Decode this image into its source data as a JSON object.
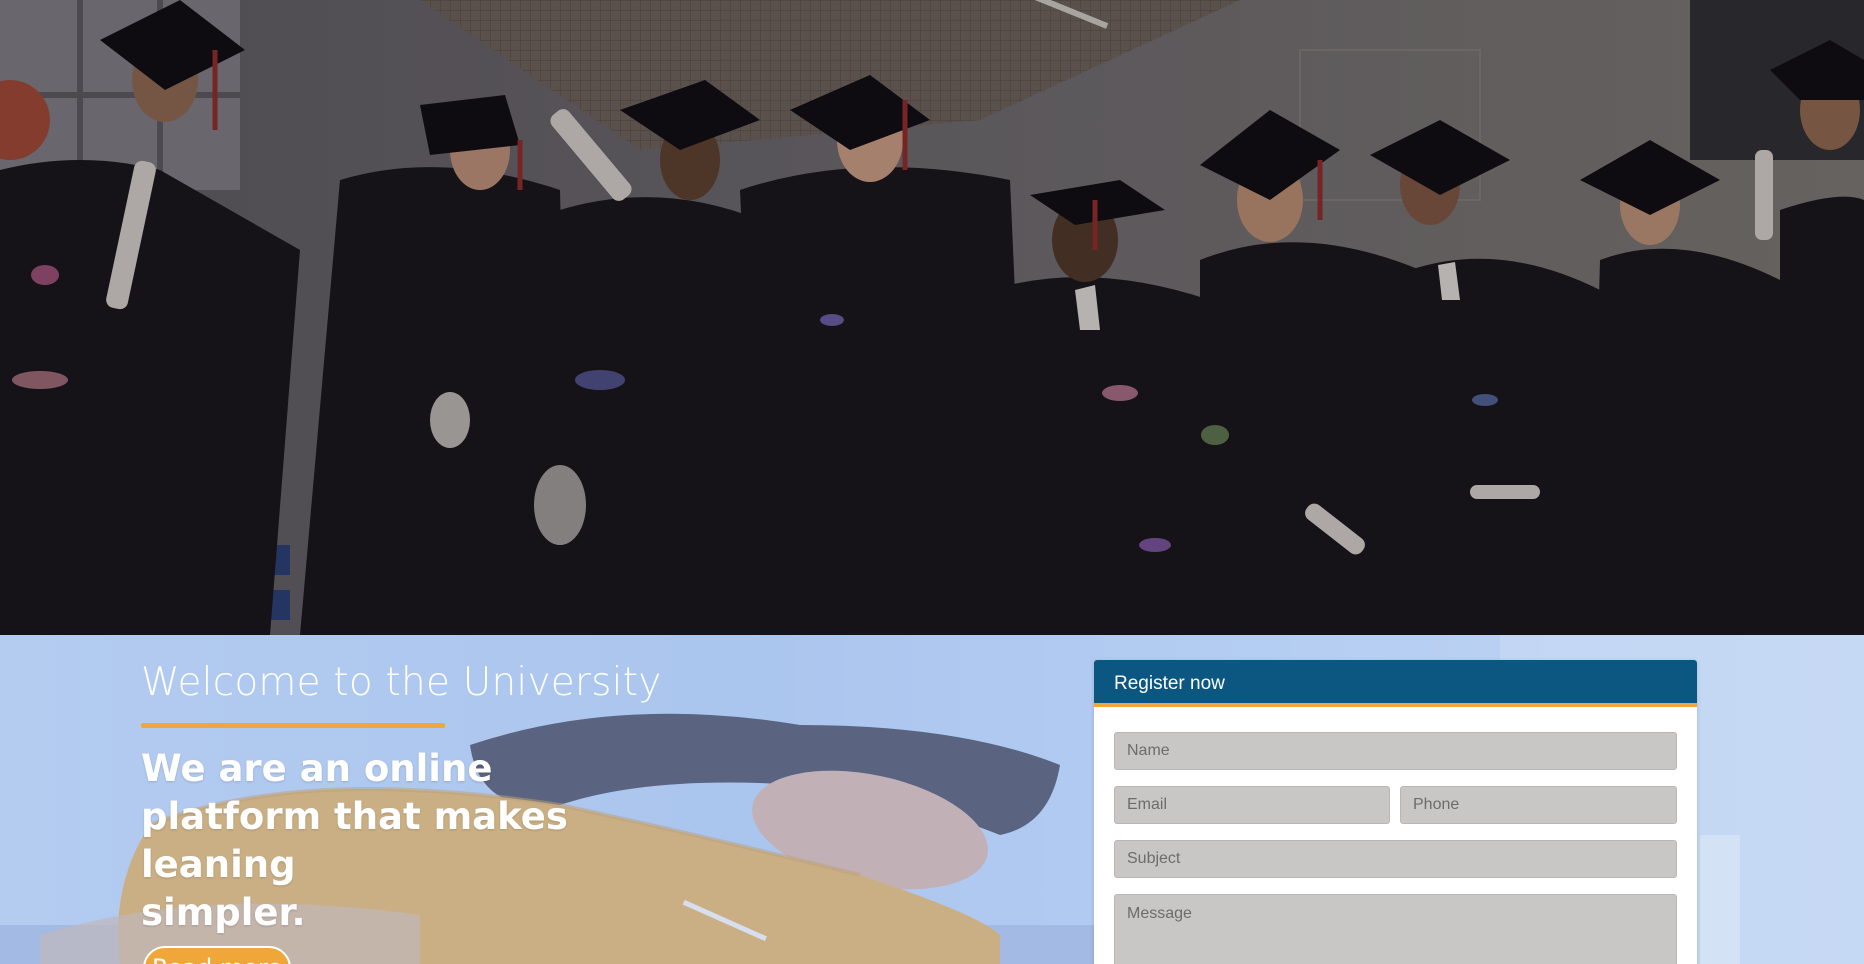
{
  "hero": {
    "image": "graduates-celebrating-photo"
  },
  "intro": {
    "welcome_title": "Welcome to the University",
    "tagline_line1": "We are an online",
    "tagline_line2": "platform that makes leaning",
    "tagline_line3": "simpler.",
    "cta_label": "Read more",
    "background_image": "student-writing-photo"
  },
  "register": {
    "title": "Register now",
    "name_placeholder": "Name",
    "email_placeholder": "Email",
    "phone_placeholder": "Phone",
    "subject_placeholder": "Subject",
    "message_placeholder": "Message"
  },
  "colors": {
    "accent": "#f0a73a",
    "header_blue": "#0b5782",
    "field_bg": "#c9c7c6",
    "section_bg": "#b7cdf0"
  }
}
